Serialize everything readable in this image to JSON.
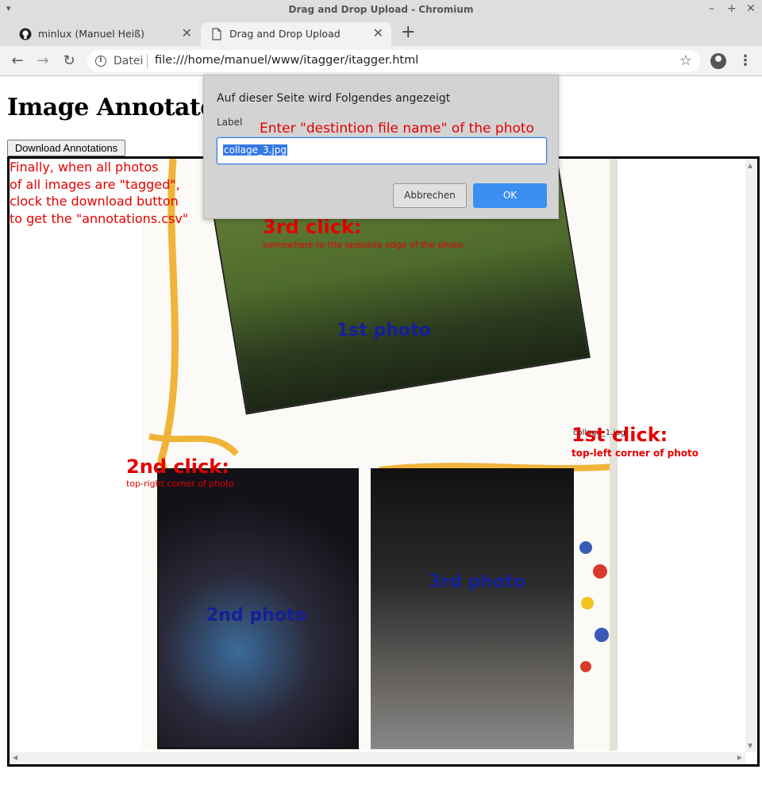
{
  "window": {
    "title": "Drag and Drop Upload - Chromium"
  },
  "tabs": [
    {
      "label": "minlux (Manuel Heiß)",
      "icon": "github-icon"
    },
    {
      "label": "Drag and Drop Upload",
      "icon": "document-icon"
    }
  ],
  "address_bar": {
    "scheme_label": "Datei",
    "url": "file:///home/manuel/www/itagger/itagger.html"
  },
  "page": {
    "heading": "Image Annotater",
    "download_button": "Download Annotations"
  },
  "dialog": {
    "message": "Auf dieser Seite wird Folgendes angezeigt",
    "field_label": "Label",
    "field_value": "collage_3.jpg",
    "cancel_label": "Abbrechen",
    "ok_label": "OK"
  },
  "annotations": {
    "dialog_hint": "Enter \"destintion file name\" of the photo",
    "note_lines": [
      "Finally, when all photos",
      "of all images are \"tagged\",",
      "clock the download button",
      "to get the \"annotations.csv\""
    ],
    "click1_title": "1st click:",
    "click1_sub": "top-left corner of photo",
    "click2_title": "2nd click:",
    "click2_sub": "top-right corner of photo",
    "click3_title": "3rd click:",
    "click3_sub": "somewhere to the opposite edge of the photo"
  },
  "photos": {
    "photo1_label": "1st photo",
    "photo2_label": "2nd photo",
    "photo3_label": "3rd photo",
    "photo1_tag": "collage_1.jpg"
  },
  "colors": {
    "annotation_red": "#e50000",
    "photo_label_blue": "#142099",
    "ok_button_blue": "#3b8ff0"
  }
}
